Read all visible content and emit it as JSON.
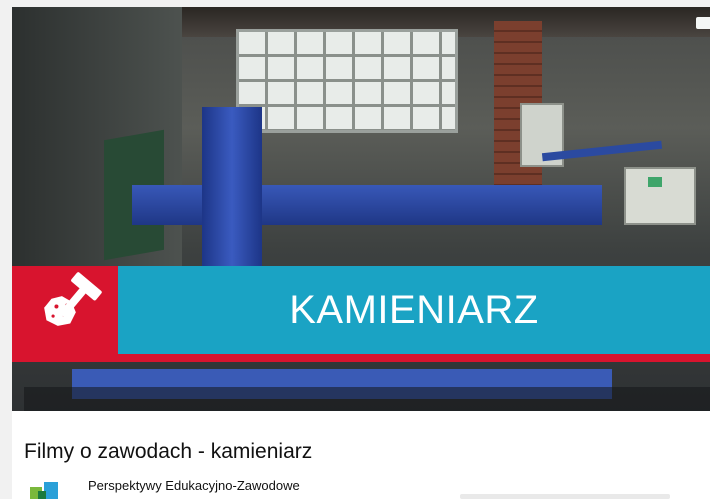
{
  "video": {
    "banner_title": "KAMIENIARZ",
    "icon": "hammer-stone-icon",
    "colors": {
      "banner_blue": "#1aa3c4",
      "banner_red": "#d8142e"
    }
  },
  "info": {
    "title": "Filmy o zawodach - kamieniarz",
    "channel_name": "Perspektywy Edukacyjno-Zawodowe",
    "channel_logo_icon": "channel-logo-icon"
  }
}
